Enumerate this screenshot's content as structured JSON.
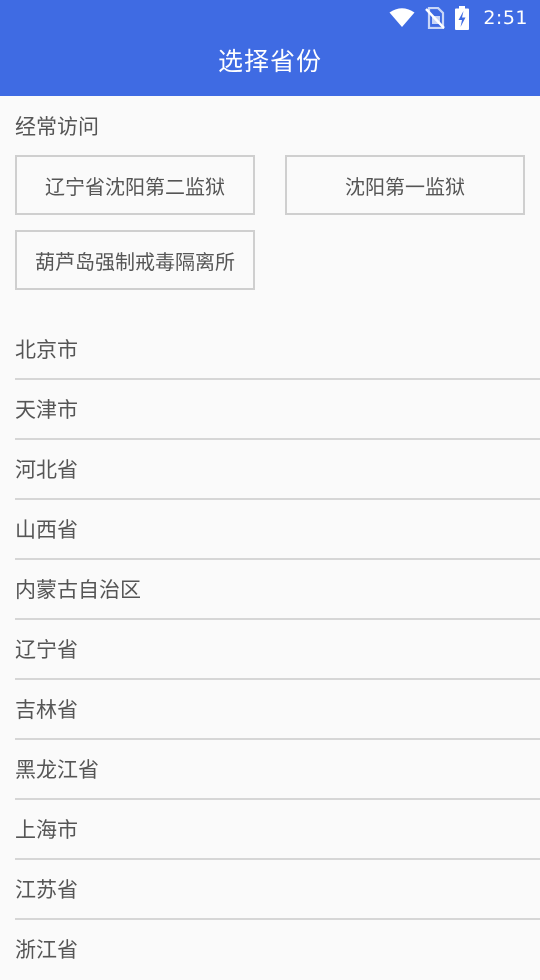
{
  "status_bar": {
    "time": "2:51",
    "icons": [
      "wifi-icon",
      "no-sim-icon",
      "battery-charging-icon"
    ]
  },
  "header": {
    "title": "选择省份",
    "background_color": "#3f6be3"
  },
  "frequent": {
    "label": "经常访问",
    "items": [
      {
        "label": "辽宁省沈阳第二监狱"
      },
      {
        "label": "沈阳第一监狱"
      },
      {
        "label": "葫芦岛强制戒毒隔离所"
      }
    ]
  },
  "provinces": [
    {
      "label": "北京市"
    },
    {
      "label": "天津市"
    },
    {
      "label": "河北省"
    },
    {
      "label": "山西省"
    },
    {
      "label": "内蒙古自治区"
    },
    {
      "label": "辽宁省"
    },
    {
      "label": "吉林省"
    },
    {
      "label": "黑龙江省"
    },
    {
      "label": "上海市"
    },
    {
      "label": "江苏省"
    },
    {
      "label": "浙江省"
    }
  ]
}
